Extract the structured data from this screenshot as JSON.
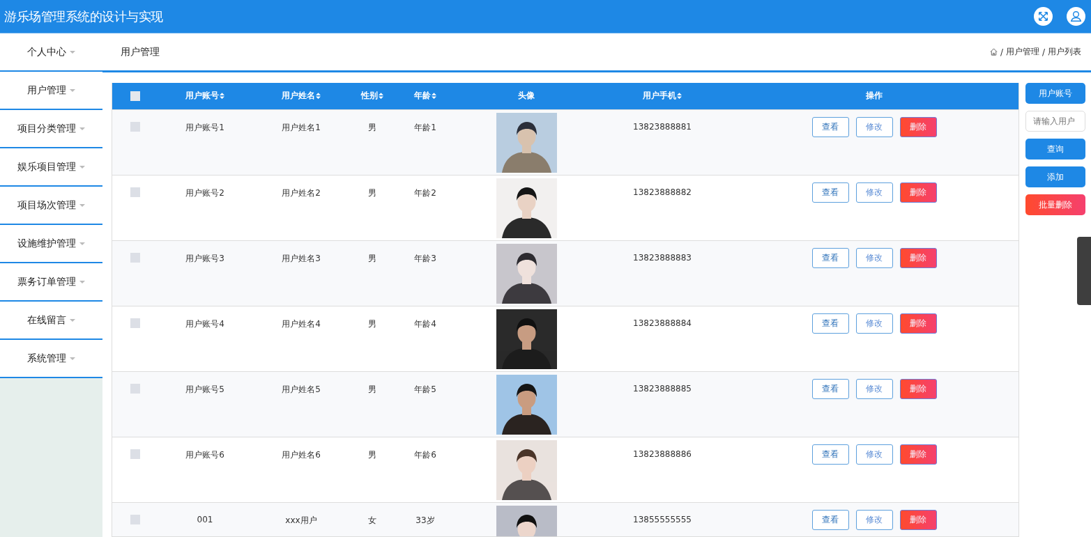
{
  "header": {
    "title": "游乐场管理系统的设计与实现"
  },
  "sidebar": {
    "items": [
      {
        "label": "个人中心"
      },
      {
        "label": "用户管理"
      },
      {
        "label": "项目分类管理"
      },
      {
        "label": "娱乐项目管理"
      },
      {
        "label": "项目场次管理"
      },
      {
        "label": "设施维护管理"
      },
      {
        "label": "票务订单管理"
      },
      {
        "label": "在线留言"
      },
      {
        "label": "系统管理"
      }
    ]
  },
  "page_bar": {
    "title": "用户管理",
    "breadcrumb": [
      {
        "separator": "/",
        "label": "用户管理"
      },
      {
        "separator": "/",
        "label": "用户列表"
      }
    ]
  },
  "table": {
    "header_checked": false,
    "columns": [
      {
        "label": "用户账号",
        "sortable": true
      },
      {
        "label": "用户姓名",
        "sortable": true
      },
      {
        "label": "性别",
        "sortable": true
      },
      {
        "label": "年龄",
        "sortable": true
      },
      {
        "label": "头像",
        "sortable": false
      },
      {
        "label": "用户手机",
        "sortable": true
      },
      {
        "label": "操作",
        "sortable": false
      }
    ],
    "rows": [
      {
        "checked": false,
        "cells": [
          "用户账号1",
          "用户姓名1",
          "男",
          "年龄1",
          {
            "kind": "picture"
          },
          "13823888881",
          [
            "查看",
            "修改",
            "删除"
          ]
        ]
      },
      {
        "checked": false,
        "cells": [
          "用户账号2",
          "用户姓名2",
          "男",
          "年龄2",
          {
            "kind": "picture"
          },
          "13823888882",
          [
            "查看",
            "修改",
            "删除"
          ]
        ]
      },
      {
        "checked": false,
        "cells": [
          "用户账号3",
          "用户姓名3",
          "男",
          "年龄3",
          {
            "kind": "picture"
          },
          "13823888883",
          [
            "查看",
            "修改",
            "删除"
          ]
        ]
      },
      {
        "checked": false,
        "cells": [
          "用户账号4",
          "用户姓名4",
          "男",
          "年龄4",
          {
            "kind": "picture"
          },
          "13823888884",
          [
            "查看",
            "修改",
            "删除"
          ]
        ]
      },
      {
        "checked": false,
        "cells": [
          "用户账号5",
          "用户姓名5",
          "男",
          "年龄5",
          {
            "kind": "picture"
          },
          "13823888885",
          [
            "查看",
            "修改",
            "删除"
          ]
        ]
      },
      {
        "checked": false,
        "cells": [
          "用户账号6",
          "用户姓名6",
          "男",
          "年龄6",
          {
            "kind": "picture"
          },
          "13823888886",
          [
            "查看",
            "修改",
            "删除"
          ]
        ]
      },
      {
        "checked": false,
        "cells": [
          "001",
          "xxx用户",
          "女",
          "33岁",
          {
            "kind": "picture"
          },
          "13855555555",
          [
            "查看",
            "修改",
            "删除"
          ]
        ]
      }
    ]
  },
  "search_panel": {
    "field_label": "用户账号",
    "placeholder": "请输入用户",
    "buttons": [
      {
        "label": "查询",
        "kind": "primary"
      },
      {
        "label": "添加",
        "kind": "primary"
      },
      {
        "label": "批量删除",
        "kind": "danger"
      }
    ]
  }
}
